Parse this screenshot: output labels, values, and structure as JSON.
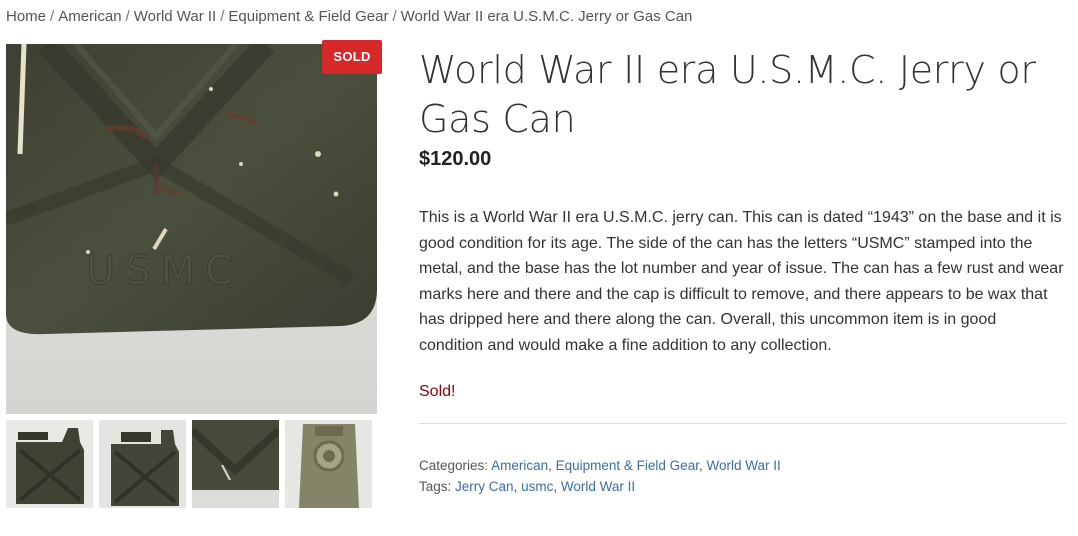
{
  "breadcrumb": {
    "items": [
      "Home",
      "American",
      "World War II",
      "Equipment & Field Gear",
      "World War II era U.S.M.C. Jerry or Gas Can"
    ],
    "separator": "/"
  },
  "product": {
    "badge": "SOLD",
    "title": "World War II era U.S.M.C. Jerry or Gas Can",
    "price": "$120.00",
    "description": "This is a World War II era U.S.M.C. jerry can. This can is dated “1943” on the base and it is good condition for its age. The side of the can has the letters “USMC” stamped into the metal, and the base has the lot number and year of issue. The can has a few rust and wear marks here and there and the cap is difficult to remove, and there appears to be wax that has dripped here and there along the can. Overall, this uncommon item is in good condition and would make a fine addition to any collection.",
    "stock_status": "Sold!"
  },
  "meta": {
    "categories_label": "Categories:",
    "categories": [
      "American",
      "Equipment & Field Gear",
      "World War II"
    ],
    "tags_label": "Tags:",
    "tags": [
      "Jerry Can",
      "usmc",
      "World War II"
    ],
    "separator": ","
  },
  "images": {
    "main_stamp_text": "USMC",
    "thumbnail_count": 4
  },
  "colors": {
    "badge": "#d62828",
    "link": "#3a6ea5",
    "stock": "#8b0000",
    "can_green": "#4a4e3c"
  }
}
